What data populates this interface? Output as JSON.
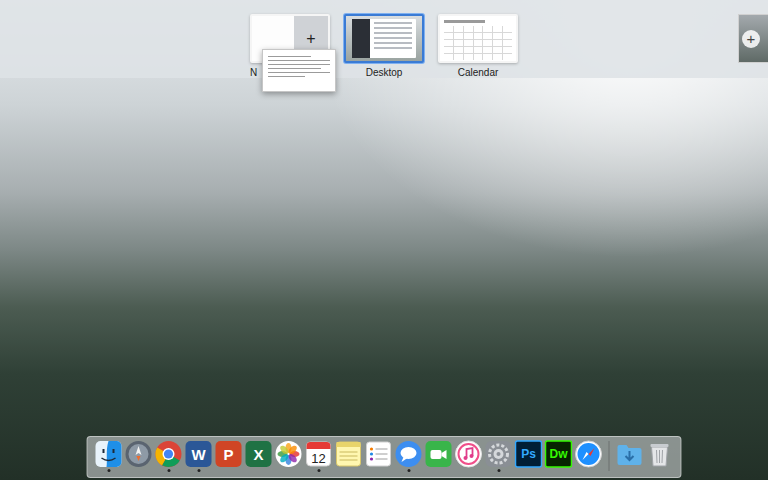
{
  "spaces_bar": {
    "spaces": [
      {
        "label": "N",
        "selected": false,
        "kind": "new",
        "icon": "+"
      },
      {
        "label": "Desktop",
        "selected": true,
        "kind": "desktop"
      },
      {
        "label": "Calendar",
        "selected": false,
        "kind": "calendar"
      }
    ],
    "add_button": {
      "icon": "+"
    }
  },
  "dock": {
    "items": [
      {
        "kind": "finder",
        "running": true
      },
      {
        "kind": "launchpad",
        "running": false
      },
      {
        "kind": "chrome",
        "running": true
      },
      {
        "kind": "word",
        "text": "W",
        "running": true
      },
      {
        "kind": "powerpoint",
        "text": "P",
        "running": false
      },
      {
        "kind": "excel",
        "text": "X",
        "running": false
      },
      {
        "kind": "photos",
        "running": false
      },
      {
        "kind": "calendar",
        "text": "12",
        "running": true
      },
      {
        "kind": "notes",
        "running": false
      },
      {
        "kind": "reminders",
        "running": false
      },
      {
        "kind": "messages",
        "running": true
      },
      {
        "kind": "facetime",
        "running": false
      },
      {
        "kind": "itunes",
        "running": false
      },
      {
        "kind": "preferences",
        "running": true
      },
      {
        "kind": "photoshop",
        "text": "Ps",
        "running": false
      },
      {
        "kind": "dreamweaver",
        "text": "Dw",
        "running": false
      },
      {
        "kind": "safari",
        "running": false
      },
      {
        "kind": "separator"
      },
      {
        "kind": "downloads",
        "running": false
      },
      {
        "kind": "trash",
        "running": false
      }
    ]
  }
}
